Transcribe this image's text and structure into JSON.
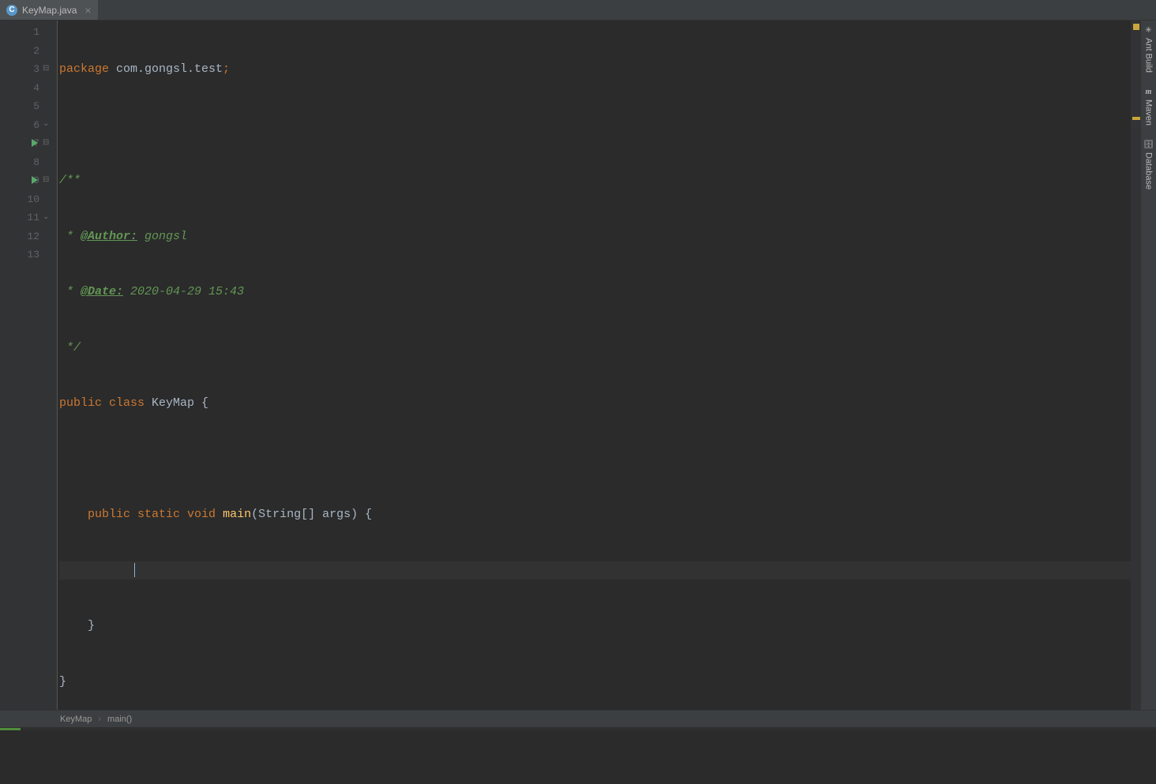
{
  "tab": {
    "filename": "KeyMap.java",
    "iconLetter": "C"
  },
  "lineNumbers": [
    "1",
    "2",
    "3",
    "4",
    "5",
    "6",
    "7",
    "8",
    "9",
    "10",
    "11",
    "12",
    "13"
  ],
  "code": {
    "pkgKw": "package ",
    "pkgName": "com.gongsl.test",
    "semicolon": ";",
    "docStart": "/**",
    "docAuthorTag": "@Author:",
    "docAuthorPrefix": " * ",
    "docAuthorVal": " gongsl",
    "docDateTag": "@Date:",
    "docDatePrefix": " * ",
    "docDateVal": " 2020-04-29 15:43",
    "docEnd": " */",
    "publicKw": "public ",
    "classKw": "class ",
    "className": "KeyMap ",
    "openBrace": "{",
    "indent1": "    ",
    "staticKw": "static ",
    "voidKw": "void ",
    "mainName": "main",
    "openParen": "(",
    "stringType": "String",
    "arrayArgs": "[] args",
    "closeParen": ") ",
    "closeBrace": "}",
    "indent2": "        "
  },
  "breadcrumb": {
    "item1": "KeyMap",
    "item2": "main()"
  },
  "sideTools": {
    "ant": "Ant Build",
    "maven": "Maven",
    "database": "Database",
    "mavenIcon": "m"
  }
}
